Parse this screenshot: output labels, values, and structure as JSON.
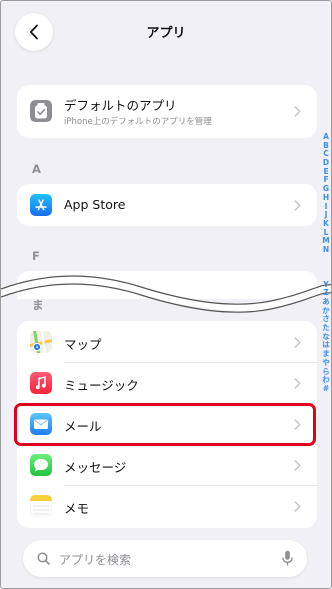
{
  "header": {
    "title": "アプリ"
  },
  "defaults": {
    "label": "デフォルトのアプリ",
    "sub": "iPhone上のデフォルトのアプリを管理"
  },
  "sections": {
    "a": {
      "header": "A",
      "items": [
        {
          "label": "App Store"
        }
      ]
    },
    "f": {
      "header": "F"
    },
    "ma": {
      "header": "ま",
      "items": [
        {
          "label": "マップ"
        },
        {
          "label": "ミュージック"
        },
        {
          "label": "メール"
        },
        {
          "label": "メッセージ"
        },
        {
          "label": "メモ"
        }
      ]
    }
  },
  "index_letters": [
    "A",
    "B",
    "C",
    "D",
    "E",
    "F",
    "G",
    "H",
    "I",
    "J",
    "K",
    "L",
    "M",
    "N",
    "Y",
    "Z",
    "あ",
    "か",
    "さ",
    "た",
    "な",
    "は",
    "ま",
    "や",
    "ら",
    "わ",
    "#"
  ],
  "search": {
    "placeholder": "アプリを検索"
  },
  "colors": {
    "accent": "#3a8ef2",
    "highlight": "#e0001b"
  }
}
